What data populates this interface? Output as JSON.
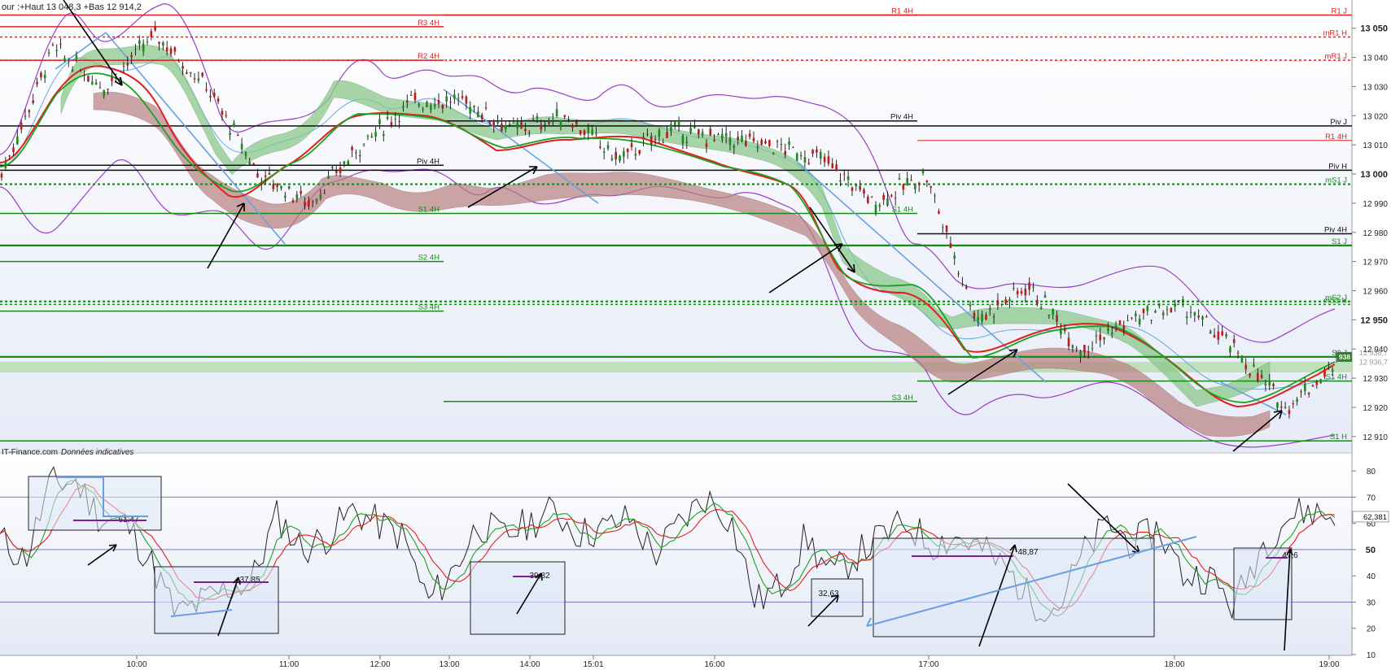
{
  "header": {
    "text": "our :+Haut 13 048,3 +Bas 12 914,2",
    "source": "IT-Finance.com",
    "source_note": "Données indicatives"
  },
  "colors": {
    "resistance": "#dd2222",
    "support": "#1a8a1a",
    "pivot": "#111111",
    "cloud_green": "#8cc98c",
    "cloud_red": "#b98080",
    "bollinger": "#9a3fc7",
    "trend_blue": "#6a9fe0",
    "ma_red": "#e02020",
    "ma_green": "#20a020",
    "current_box": "#2f7d2f",
    "rsi_line": "#222222",
    "annot_box": "#dde7f7"
  },
  "chart_data": [
    {
      "type": "line",
      "panel": "price",
      "x_ticks": [
        "10:00",
        "11:00",
        "12:00",
        "13:00",
        "14:00",
        "15:01",
        "16:00",
        "17:00",
        "18:00",
        "19:00"
      ],
      "ylim": [
        12908,
        13058
      ],
      "y_ticks": [
        "13 050",
        "13 040",
        "13 030",
        "13 020",
        "13 010",
        "13 000",
        "12 990",
        "12 980",
        "12 970",
        "12 960",
        "12 950",
        "12 940",
        "12 930",
        "12 920",
        "12 910"
      ],
      "y_ticks_bold": [
        "13 050",
        "13 000",
        "12 950"
      ],
      "series": [
        {
          "values": [
            13000,
            13043,
            13030,
            13048,
            13030,
            13000,
            12990,
            13010,
            13025,
            13025,
            13015,
            13020,
            13005,
            13015,
            13012,
            13010,
            13005,
            12990,
            13000,
            12950,
            12962,
            12940,
            12950,
            12955,
            12940,
            12920,
            12935
          ]
        }
      ],
      "levels": [
        {
          "label": "R1 J",
          "value": 13054.5,
          "side": "right",
          "kind": "resistance",
          "style": "solid"
        },
        {
          "label": "R1 4H",
          "value": 13054.5,
          "side": "mid2",
          "kind": "resistance",
          "style": "solid"
        },
        {
          "label": "R3 4H",
          "value": 13050.5,
          "side": "mid1",
          "kind": "resistance",
          "style": "solid"
        },
        {
          "label": "mR1 H",
          "value": 13047,
          "side": "right",
          "kind": "resistance",
          "style": "dashed"
        },
        {
          "label": "mR1 J",
          "value": 13039,
          "side": "right",
          "kind": "resistance",
          "style": "dashed"
        },
        {
          "label": "R2 4H",
          "value": 13039,
          "side": "mid1",
          "kind": "resistance",
          "style": "solid"
        },
        {
          "label": "Piv 4H",
          "value": 13018.2,
          "side": "mid2",
          "kind": "pivot",
          "style": "solid"
        },
        {
          "label": "Piv J",
          "value": 13016.5,
          "side": "right",
          "kind": "pivot",
          "style": "solid"
        },
        {
          "label": "R1 4H",
          "value": 13011.5,
          "side": "right",
          "kind": "resistance",
          "style": "thin"
        },
        {
          "label": "Piv 4H",
          "value": 13003,
          "side": "mid1",
          "kind": "pivot",
          "style": "solid"
        },
        {
          "label": "Piv H",
          "value": 13001.3,
          "side": "right",
          "kind": "pivot",
          "style": "solid"
        },
        {
          "label": "mS1 J",
          "value": 12996.5,
          "side": "right",
          "kind": "support",
          "style": "dashed"
        },
        {
          "label": "S1 4H",
          "value": 12986.5,
          "side": "mid1",
          "kind": "support",
          "style": "solid"
        },
        {
          "label": "S1 4H",
          "value": 12986.5,
          "side": "mid2",
          "kind": "support",
          "style": "solid"
        },
        {
          "label": "Piv 4H",
          "value": 12979.5,
          "side": "right",
          "kind": "pivot",
          "style": "solid"
        },
        {
          "label": "S1 J",
          "value": 12975.5,
          "side": "right",
          "kind": "support",
          "style": "solid"
        },
        {
          "label": "S2 4H",
          "value": 12970,
          "side": "mid1",
          "kind": "support",
          "style": "solid"
        },
        {
          "label": "mS2 J",
          "value": 12956.3,
          "side": "right",
          "kind": "support",
          "style": "dashed"
        },
        {
          "label": "mS1 H",
          "value": 12955.3,
          "side": "right",
          "kind": "support",
          "style": "dashed"
        },
        {
          "label": "S3 4H",
          "value": 12953,
          "side": "mid1",
          "kind": "support",
          "style": "solid"
        },
        {
          "label": "S2 J",
          "value": 12937.3,
          "side": "right",
          "kind": "support",
          "style": "solid"
        },
        {
          "label": "S1 4H",
          "value": 12929,
          "side": "right",
          "kind": "support",
          "style": "solid"
        },
        {
          "label": "S3 4H",
          "value": 12922,
          "side": "mid2",
          "kind": "support",
          "style": "solid"
        },
        {
          "label": "S1 H",
          "value": 12908.5,
          "side": "right",
          "kind": "support",
          "style": "solid"
        }
      ],
      "price_tags": [
        {
          "text": "12 938,7",
          "value": 12938.7
        },
        {
          "text": "938",
          "value": 12937.3,
          "current": true
        },
        {
          "text": "12 936,7",
          "value": 12935.5
        }
      ]
    },
    {
      "type": "line",
      "panel": "rsi",
      "ylim": [
        10,
        85
      ],
      "y_ticks": [
        "80",
        "70",
        "60",
        "50",
        "40",
        "30",
        "20",
        "10"
      ],
      "y_ticks_bold": [
        "50"
      ],
      "series": [
        {
          "values": [
            54,
            46,
            75,
            76,
            62,
            60,
            45,
            25,
            30,
            35,
            38,
            63,
            50,
            55,
            65,
            60,
            55,
            30,
            42,
            60,
            55,
            60,
            65,
            56,
            58,
            62,
            48,
            60,
            70,
            62,
            30,
            36,
            55,
            40,
            48,
            55,
            60,
            52,
            55,
            50,
            42,
            30,
            28,
            48,
            60,
            52,
            58,
            40,
            40,
            28,
            50,
            62,
            65,
            62
          ]
        }
      ],
      "current": "62,381",
      "annotations": [
        "61,47",
        "37,85",
        "39,82",
        "32,63",
        "48,87",
        "47,6"
      ]
    }
  ]
}
